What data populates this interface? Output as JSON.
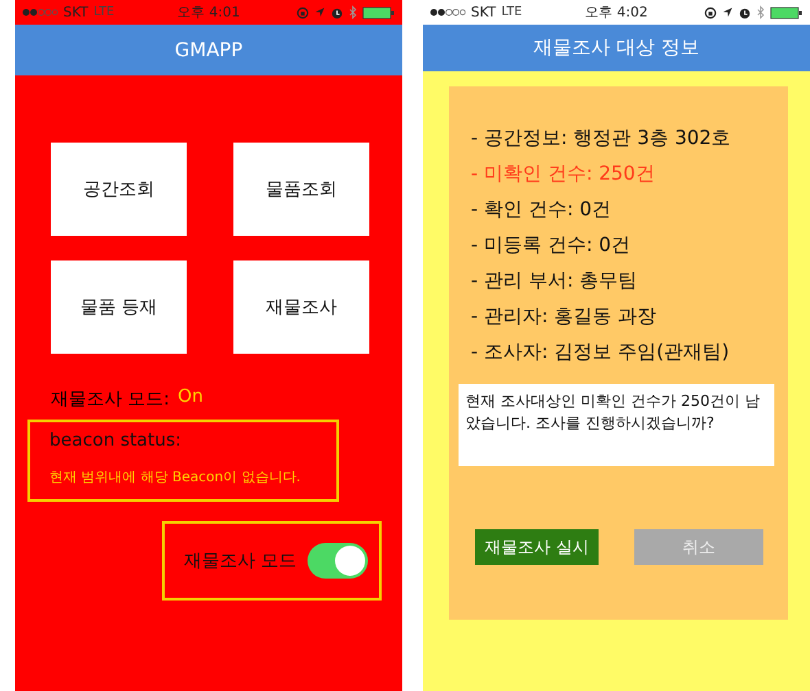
{
  "screens": [
    {
      "status_bar": {
        "carrier": "SKT",
        "network": "LTE",
        "time": "오후 4:01"
      },
      "title": "GMAPP",
      "menu_buttons": [
        {
          "label": "공간조회"
        },
        {
          "label": "물품조회"
        },
        {
          "label": "물품 등재"
        },
        {
          "label": "재물조사"
        }
      ],
      "mode": {
        "label": "재물조사 모드:",
        "value": "On"
      },
      "beacon": {
        "label": "beacon status:",
        "message": "현재 범위내에 해당 Beacon이 없습니다."
      },
      "toggle": {
        "label": "재물조사 모드",
        "on": true
      }
    },
    {
      "status_bar": {
        "carrier": "SKT",
        "network": "LTE",
        "time": "오후 4:02"
      },
      "title": "재물조사 대상 정보",
      "info_items": [
        {
          "text": "- 공간정보: 행정관 3층 302호",
          "highlighted": false
        },
        {
          "text": "- 미확인 건수: 250건",
          "highlighted": true
        },
        {
          "text": "- 확인 건수: 0건",
          "highlighted": false
        },
        {
          "text": "- 미등록 건수: 0건",
          "highlighted": false
        },
        {
          "text": "- 관리 부서: 총무팀",
          "highlighted": false
        },
        {
          "text": "- 관리자: 홍길동 과장",
          "highlighted": false
        },
        {
          "text": "- 조사자: 김정보 주임(관재팀)",
          "highlighted": false
        }
      ],
      "message": "현재 조사대상인 미확인 건수가 250건이 남았습니다. 조사를 진행하시겠습니까?",
      "buttons": [
        {
          "label": "재물조사 실시",
          "kind": "primary"
        },
        {
          "label": "취소",
          "kind": "secondary"
        }
      ]
    }
  ]
}
